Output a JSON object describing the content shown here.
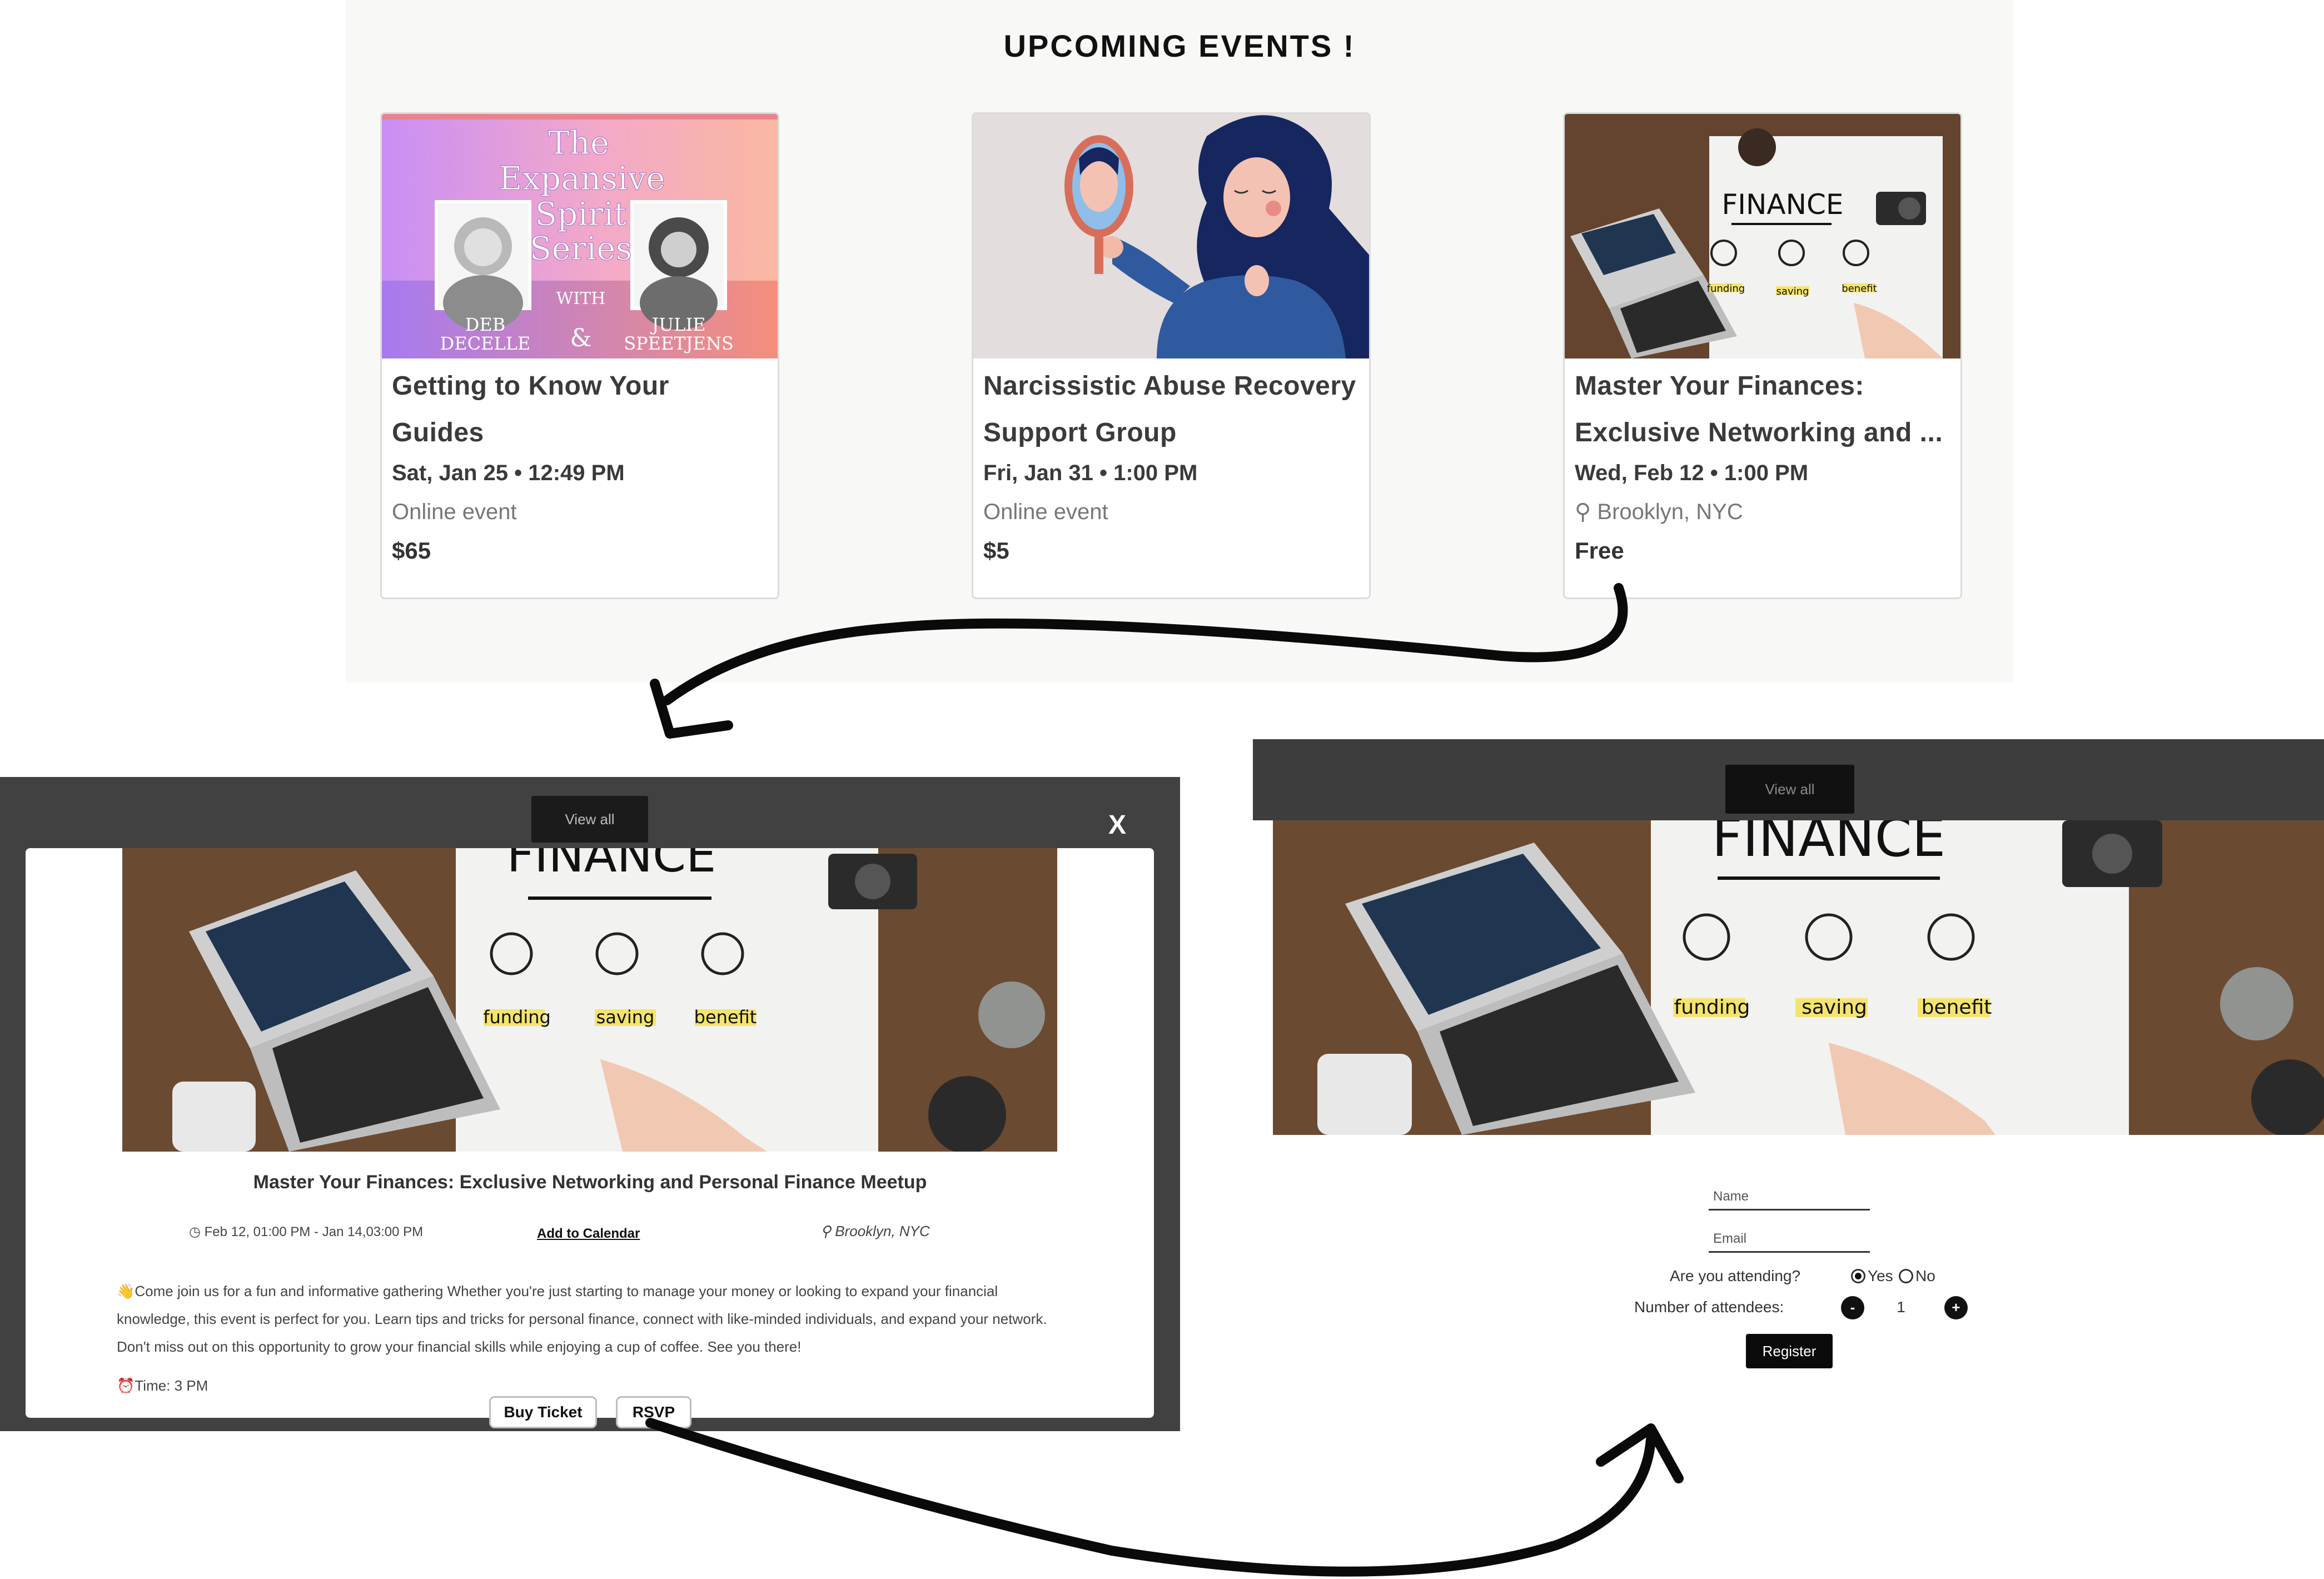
{
  "events": {
    "heading": "UPCOMING EVENTS !",
    "cards": [
      {
        "title": "Getting to Know Your Guides",
        "date": "Sat, Jan 25 • 12:49 PM",
        "location": "Online event",
        "price": "$65",
        "image": {
          "series_title_1": "The",
          "series_title_2": "Expansive",
          "series_title_3": "Spirit",
          "series_title_4": "Series",
          "with": "WITH",
          "amp": "&",
          "host1_line1": "DEB",
          "host1_line2": "DECELLE",
          "host2_line1": "JULIE",
          "host2_line2": "SPEETJENS"
        }
      },
      {
        "title": "Narcissistic Abuse Recovery Support Group",
        "date": "Fri, Jan 31 • 1:00 PM",
        "location": "Online event",
        "price": "$5"
      },
      {
        "title": "Master Your Finances: Exclusive Networking and ...",
        "date": "Wed, Feb 12 • 1:00 PM",
        "location": "⚲ Brooklyn, NYC",
        "price": "Free",
        "image": {
          "word": "FINANCE",
          "label1": "funding",
          "label2": "saving",
          "label3": "benefit"
        }
      }
    ]
  },
  "modal": {
    "view_all": "View all",
    "close": "X",
    "image": {
      "word": "FINANCE",
      "label1": "funding",
      "label2": "saving",
      "label3": "benefit"
    },
    "title": "Master Your Finances: Exclusive Networking and Personal Finance Meetup",
    "date_range": "◷ Feb 12, 01:00 PM - Jan 14,03:00 PM",
    "add_to_calendar": "Add to Calendar",
    "location": "⚲ Brooklyn, NYC",
    "description": "👋Come join us for a fun and informative gathering Whether you're just starting to manage your money or looking to expand your financial knowledge, this event is perfect for you. Learn tips and tricks for personal finance, connect with like-minded individuals, and expand your network. Don't miss out on this opportunity to grow your financial skills while enjoying a cup of coffee. See you there!",
    "time": "⏰Time: 3 PM",
    "buy_ticket": "Buy Ticket",
    "rsvp": "RSVP"
  },
  "rsvp_page": {
    "view_all": "View all",
    "image": {
      "word": "FINANCE",
      "label1": "funding",
      "label2": "saving",
      "label3": "benefit"
    },
    "name_placeholder": "Name",
    "email_placeholder": "Email",
    "attending_question": "Are you attending?",
    "yes_label": "Yes",
    "no_label": "No",
    "attending_selected": "Yes",
    "attendees_label": "Number of attendees:",
    "decrement": "-",
    "increment": "+",
    "attendee_count": "1",
    "register": "Register"
  },
  "colors": {
    "panel_bg": "#f8f8f6",
    "modal_backdrop": "#414141",
    "header_dark": "#3d3d3d",
    "button_dark": "#0a0a0a",
    "card_border": "#dcdcdc"
  }
}
